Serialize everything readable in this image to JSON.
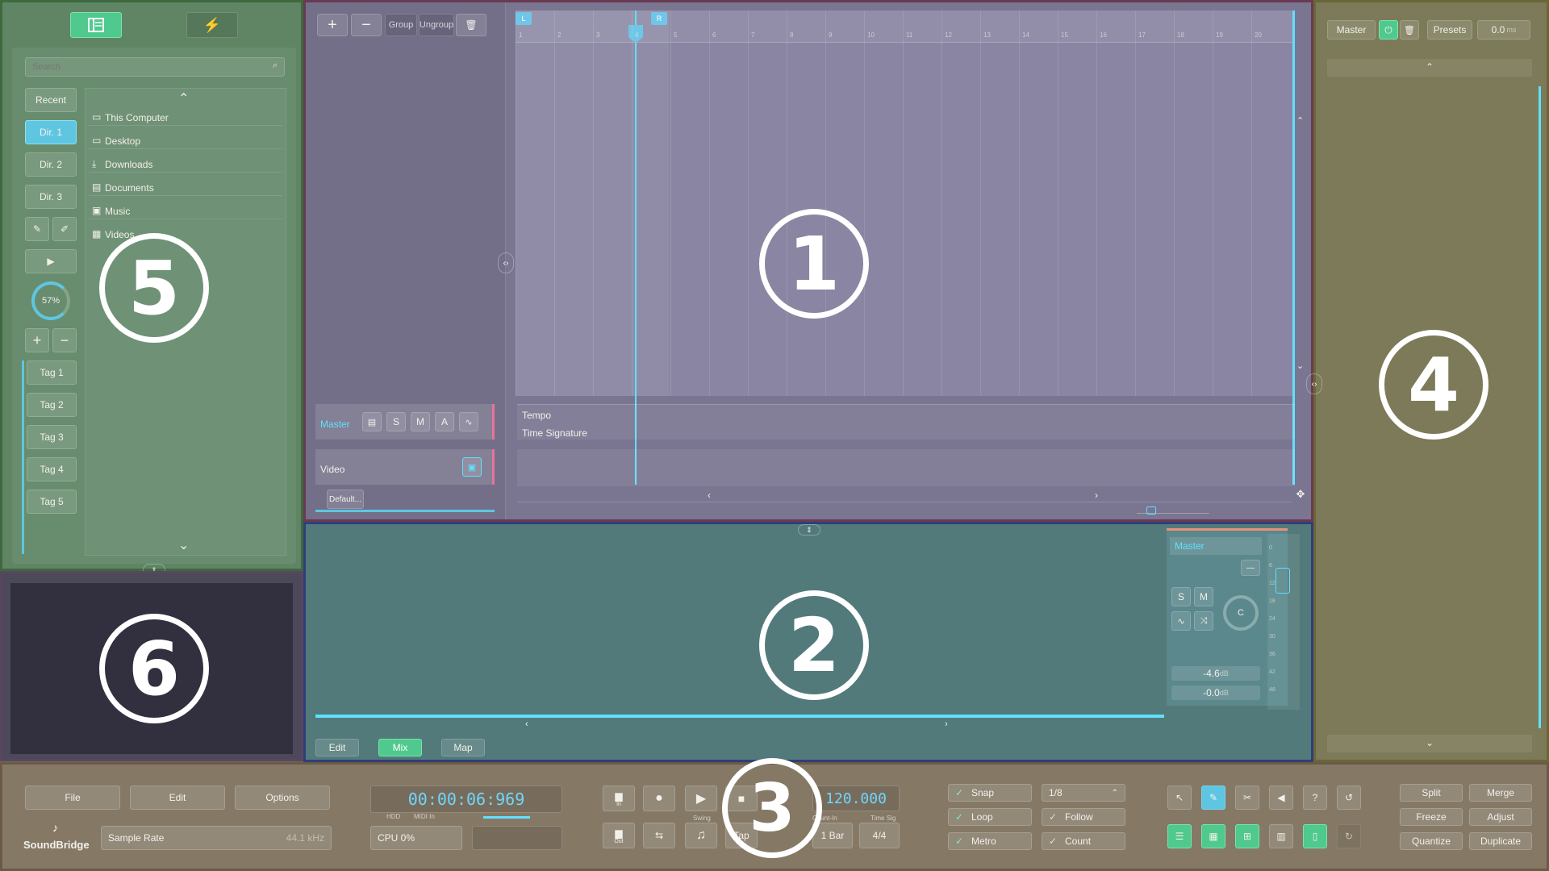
{
  "browser": {
    "search_placeholder": "Search",
    "left_buttons": [
      "Recent",
      "Dir. 1",
      "Dir. 2",
      "Dir. 3"
    ],
    "tags": [
      "Tag 1",
      "Tag 2",
      "Tag 3",
      "Tag 4",
      "Tag 5"
    ],
    "knob_value": "57%",
    "locations": [
      "This Computer",
      "Desktop",
      "Downloads",
      "Documents",
      "Music",
      "Videos"
    ]
  },
  "arrange": {
    "toolbar": {
      "group": "Group",
      "ungroup": "Ungroup"
    },
    "ruler": [
      "1",
      "2",
      "3",
      "4",
      "5",
      "6",
      "7",
      "8",
      "9",
      "10",
      "11",
      "12",
      "13",
      "14",
      "15",
      "16",
      "17",
      "18",
      "19",
      "20"
    ],
    "loop_start": "L",
    "loop_end": "R",
    "master_track": "Master",
    "master_buttons": [
      "S",
      "M",
      "A"
    ],
    "video_track": "Video",
    "template_tab": "Default...",
    "tempo": "Tempo",
    "time_signature": "Time Signature"
  },
  "mixer": {
    "channel": "Master",
    "knob_label": "C",
    "volume": "-4.6",
    "pan": "-0.0",
    "unit": "dB",
    "scale": [
      "0",
      "6",
      "12",
      "18",
      "24",
      "30",
      "36",
      "42",
      "48"
    ],
    "tabs": [
      "Edit",
      "Mix",
      "Map"
    ]
  },
  "inspector": {
    "master": "Master",
    "presets": "Presets",
    "value": "0.0",
    "unit": "ms"
  },
  "transport": {
    "menu": {
      "file": "File",
      "edit": "Edit",
      "options": "Options"
    },
    "logo": "SoundBridge",
    "sample_rate_label": "Sample Rate",
    "sample_rate_value": "44.1 kHz",
    "time": "00:00:06:969",
    "hdd": "HDD",
    "midi_in": "MIDI In",
    "cpu": "CPU 0%",
    "in_label": "In",
    "out_label": "Out",
    "swing_label": "Swing",
    "tap": "Tap",
    "tempo": "120.000",
    "count_in_label": "Count-In",
    "count_in_value": "1 Bar",
    "time_sig_label": "Time Sig",
    "time_sig_value": "4/4",
    "snap": "Snap",
    "snap_value": "1/8",
    "loop": "Loop",
    "follow": "Follow",
    "metro": "Metro",
    "count": "Count",
    "right_buttons": [
      "Split",
      "Merge",
      "Freeze",
      "Adjust",
      "Quantize",
      "Duplicate"
    ]
  },
  "zone_numbers": [
    "1",
    "2",
    "3",
    "4",
    "5",
    "6"
  ],
  "colors": {
    "accent": "#4fc98d",
    "cyan": "#5fe0ff",
    "zone1": "#7a7590",
    "zone2": "#537a7a",
    "zone4": "#7c7a58",
    "zone5": "#5f8565"
  }
}
